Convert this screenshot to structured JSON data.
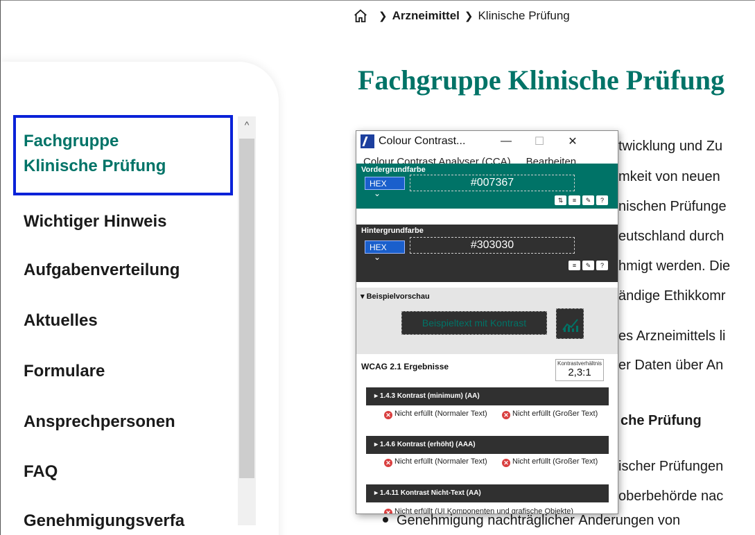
{
  "breadcrumb": {
    "home_icon": "home-icon",
    "items": [
      "Arzneimittel",
      "Klinische Prüfung"
    ]
  },
  "page": {
    "title": "Fachgruppe Klinische Prüfung",
    "para1": [
      "twicklung und Zu",
      "mkeit von neuen",
      "nischen Prüfunge",
      "eutschland durch",
      "hmigt werden. Die",
      "ändige Ethikkomr"
    ],
    "para2": [
      "es Arzneimittels li",
      "er Daten über An"
    ],
    "section_heading": "che Prüfung",
    "para3": [
      "ischer Prüfungen",
      "oberbehörde nac"
    ],
    "bullet": "Genehmigung nachträglicher Änderungen von"
  },
  "sidebar": {
    "items": [
      {
        "label": "Fachgruppe Klinische Prüfung",
        "line1": "Fachgruppe",
        "line2": "Klinische Prüfung",
        "active": true
      },
      {
        "label": "Wichtiger Hinweis"
      },
      {
        "label": "Aufgabenverteilung"
      },
      {
        "label": "Aktuelles"
      },
      {
        "label": "Formulare"
      },
      {
        "label": "Ansprechpersonen"
      },
      {
        "label": "FAQ"
      },
      {
        "label": "Genehmigungsverfa"
      }
    ],
    "scroll_up_glyph": "^"
  },
  "cca": {
    "title": "Colour Contrast...",
    "menu": [
      "Colour Contrast Analyser (CCA)",
      "Bearbeiten"
    ],
    "foreground": {
      "label": "Vordergrundfarbe",
      "format": "HEX",
      "value": "#007367",
      "color": "#007367"
    },
    "background": {
      "label": "Hintergrundfarbe",
      "format": "HEX",
      "value": "#303030",
      "color": "#303030"
    },
    "preview": {
      "label": "Beispielvorschau",
      "sample_text": "Beispieltext mit Kontrast"
    },
    "results": {
      "label": "WCAG 2.1 Ergebnisse",
      "ratio_label": "Kontrastverhältnis",
      "ratio": "2,3:1",
      "criteria": [
        {
          "title": "1.4.3 Kontrast (minimum) (AA)",
          "left": "Nicht erfüllt (Normaler Text)",
          "right": "Nicht erfüllt (Großer Text)"
        },
        {
          "title": "1.4.6 Kontrast (erhöht) (AAA)",
          "left": "Nicht erfüllt (Normaler Text)",
          "right": "Nicht erfüllt (Großer Text)"
        },
        {
          "title": "1.4.11 Kontrast Nicht-Text (AA)",
          "left": "Nicht erfüllt (UI Komponenten und grafische Objekte)"
        }
      ]
    }
  },
  "colors": {
    "accent": "#007367",
    "focus": "#0a22d8",
    "dark": "#303030"
  }
}
